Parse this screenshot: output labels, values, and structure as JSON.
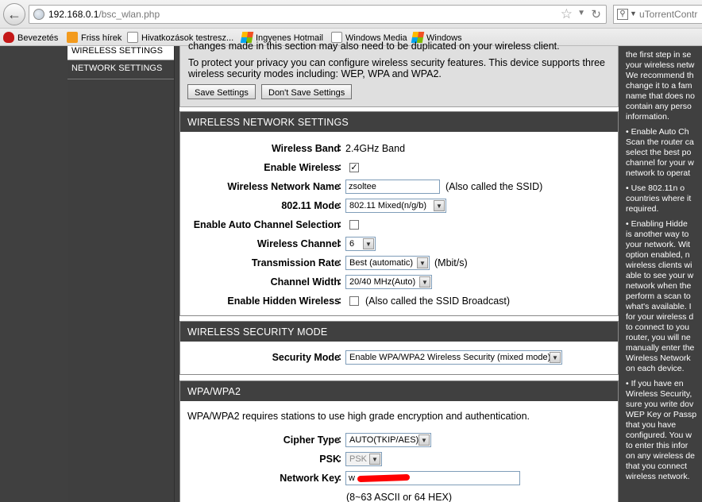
{
  "browser": {
    "url_host": "192.168.0.1",
    "url_path": "/bsc_wlan.php",
    "search_placeholder": "uTorrentContr",
    "bookmarks": [
      "Bevezetés",
      "Friss hírek",
      "Hivatkozások testresz...",
      "Ingyenes Hotmail",
      "Windows Media",
      "Windows"
    ]
  },
  "sidebar": {
    "items": [
      "WIRELESS SETTINGS",
      "NETWORK SETTINGS"
    ]
  },
  "intro": {
    "cut_text": "changes made in this section may also need to be duplicated on your wireless client.",
    "text": "To protect your privacy you can configure wireless security features. This device supports three wireless security modes including: WEP, WPA and WPA2.",
    "save_label": "Save Settings",
    "dont_save_label": "Don't Save Settings"
  },
  "wireless_network": {
    "title": "WIRELESS NETWORK SETTINGS",
    "band_label": "Wireless Band",
    "band_value": "2.4GHz Band",
    "enable_label": "Enable Wireless",
    "enable_checked": "✓",
    "name_label": "Wireless Network Name",
    "name_value": "zsoltee",
    "name_note": "(Also called the SSID)",
    "mode_label": "802.11 Mode",
    "mode_value": "802.11 Mixed(n/g/b)",
    "auto_channel_label": "Enable Auto Channel Selection",
    "channel_label": "Wireless Channel",
    "channel_value": "6",
    "rate_label": "Transmission Rate",
    "rate_value": "Best (automatic)",
    "rate_unit": "(Mbit/s)",
    "width_label": "Channel Width",
    "width_value": "20/40 MHz(Auto)",
    "hidden_label": "Enable Hidden Wireless",
    "hidden_note": "(Also called the SSID Broadcast)"
  },
  "security_mode": {
    "title": "WIRELESS SECURITY MODE",
    "mode_label": "Security Mode",
    "mode_value": "Enable WPA/WPA2 Wireless Security (mixed mode)"
  },
  "wpa": {
    "title": "WPA/WPA2",
    "description": "WPA/WPA2 requires stations to use high grade encryption and authentication.",
    "cipher_label": "Cipher Type",
    "cipher_value": "AUTO(TKIP/AES)",
    "psk_label": "PSK",
    "psk_value": "PSK",
    "key_label": "Network Key",
    "key_value": "w",
    "key_note": "(8~63 ASCII or 64 HEX)"
  },
  "help": {
    "p1": "the first step in se\nyour wireless netw\nWe recommend th\nchange it to a fam\nname that does no\ncontain any perso\ninformation.",
    "p2": "• Enable Auto Ch\nScan the router ca\nselect the best po\nchannel for your w\nnetwork to operat",
    "p3": "• Use 802.11n o\ncountries where it\nrequired.",
    "p4": "• Enabling Hidde\nis another way to\nyour network. Wit\noption enabled, n\nwireless clients wi\nable to see your w\nnetwork when the\nperform a scan to\nwhat's available. I\nfor your wireless d\nto connect to you\nrouter, you will ne\nmanually enter the\nWireless Network\non each device.",
    "p5": "• If you have en\nWireless Security,\nsure you write dov\nWEP Key or Passp\nthat you have\nconfigured. You w\nto enter this infor\non any wireless de\nthat you connect\nwireless network."
  }
}
